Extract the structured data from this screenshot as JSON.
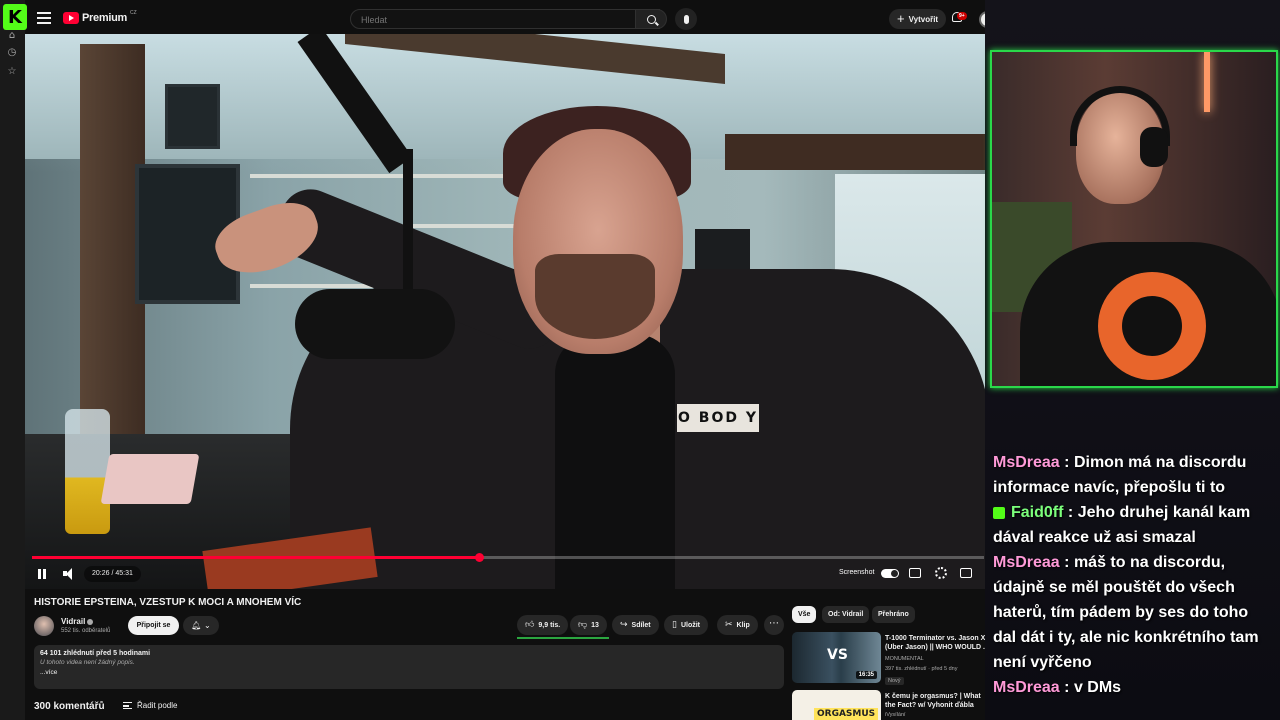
{
  "rail": {
    "logo_letter": "K"
  },
  "topbar": {
    "brand": "Premium",
    "country": "CZ",
    "search_placeholder": "Hledat",
    "create_label": "Vytvořit",
    "notifications_badge": "9+"
  },
  "player": {
    "time": "20:26 / 45:31",
    "progress": 0.47,
    "screenshot_label": "Screenshot",
    "jacket_text": "O BOD Y"
  },
  "video": {
    "title": "HISTORIE EPSTEINA, VZESTUP K MOCI A MNOHEM VÍC",
    "channel": "Vidrail",
    "subscribers": "552 tis. odběratelů",
    "join_label": "Připojit se",
    "likes": "9,9 tis.",
    "dislikes": "13",
    "share_label": "Sdílet",
    "save_label": "Uložit",
    "clip_label": "Klip",
    "views_time": "64 101 zhlédnutí  před 5 hodinami",
    "description": "U tohoto videa není žádný popis.",
    "more_label": "...více",
    "comments_count": "300 komentářů",
    "sort_label": "Řadit podle"
  },
  "recommendations": {
    "chips": [
      "Vše",
      "Od: Vidrail",
      "Přehráno"
    ],
    "items": [
      {
        "title": "T-1000 Terminator vs. Jason X (Uber Jason) || WHO WOULD ...",
        "channel": "MONUMENTAL",
        "meta": "397 tis. zhlédnutí · před 5 dny",
        "duration": "16:35",
        "badge": "Nový",
        "thumb_text": "VS"
      },
      {
        "title": "K čemu je orgasmus? | What the Fact? w/ Vyhonit ďábla",
        "channel": "iVysílání",
        "thumb_text": "ORGASMUS"
      }
    ]
  },
  "chat": {
    "messages": [
      {
        "user": "MsDreaa",
        "text": "Dimon má na discordu informace navíc, přepošlu ti to",
        "color": "#ff9ad8"
      },
      {
        "user": "Faid0ff",
        "text": "Jeho druhej kanál kam dával reakce už asi smazal",
        "color": "#7cff7c"
      },
      {
        "user": "MsDreaa",
        "text": "máš to na discordu, údajně se měl pouštět do všech haterů, tím pádem by ses do toho dal dát i ty, ale nic konkrétního tam není vyřčeno",
        "color": "#ff9ad8"
      },
      {
        "user": "MsDreaa",
        "text": "v DMs",
        "color": "#ff9ad8"
      }
    ]
  },
  "colors": {
    "kick_green": "#53fc18",
    "yt_red": "#ff0033",
    "webcam_border": "#2ad84a"
  }
}
